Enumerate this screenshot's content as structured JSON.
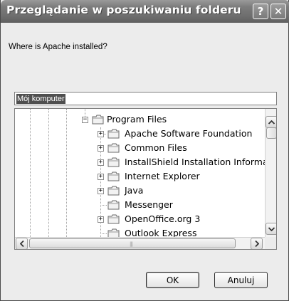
{
  "dialog": {
    "title": "Przeglądanie w poszukiwaniu folderu",
    "help_label": "?",
    "close_label": "✕",
    "prompt": "Where is Apache installed?",
    "folder_field": {
      "value": "Mój komputer"
    },
    "buttons": {
      "ok_label": "OK",
      "cancel_label": "Anuluj"
    }
  },
  "tree": {
    "items": [
      {
        "label": "Program Files",
        "expander": "−",
        "expanded": true
      },
      {
        "label": "Apache Software Foundation",
        "expander": "+"
      },
      {
        "label": "Common Files",
        "expander": "+"
      },
      {
        "label": "InstallShield Installation Informat",
        "expander": "+"
      },
      {
        "label": "Internet Explorer",
        "expander": "+"
      },
      {
        "label": "Java",
        "expander": "+"
      },
      {
        "label": "Messenger",
        "expander": ""
      },
      {
        "label": "OpenOffice.org 3",
        "expander": "+"
      },
      {
        "label": "Outlook Express",
        "expander": ""
      }
    ]
  },
  "icons": {
    "folder": "folder-icon",
    "scroll_up": "arrow-up-icon",
    "scroll_down": "arrow-down-icon",
    "scroll_left": "arrow-left-icon",
    "scroll_right": "arrow-right-icon"
  },
  "colors": {
    "titlebar": "#6e6e6e",
    "dialog_bg": "#ececec",
    "selection": "#4f4f4f"
  }
}
